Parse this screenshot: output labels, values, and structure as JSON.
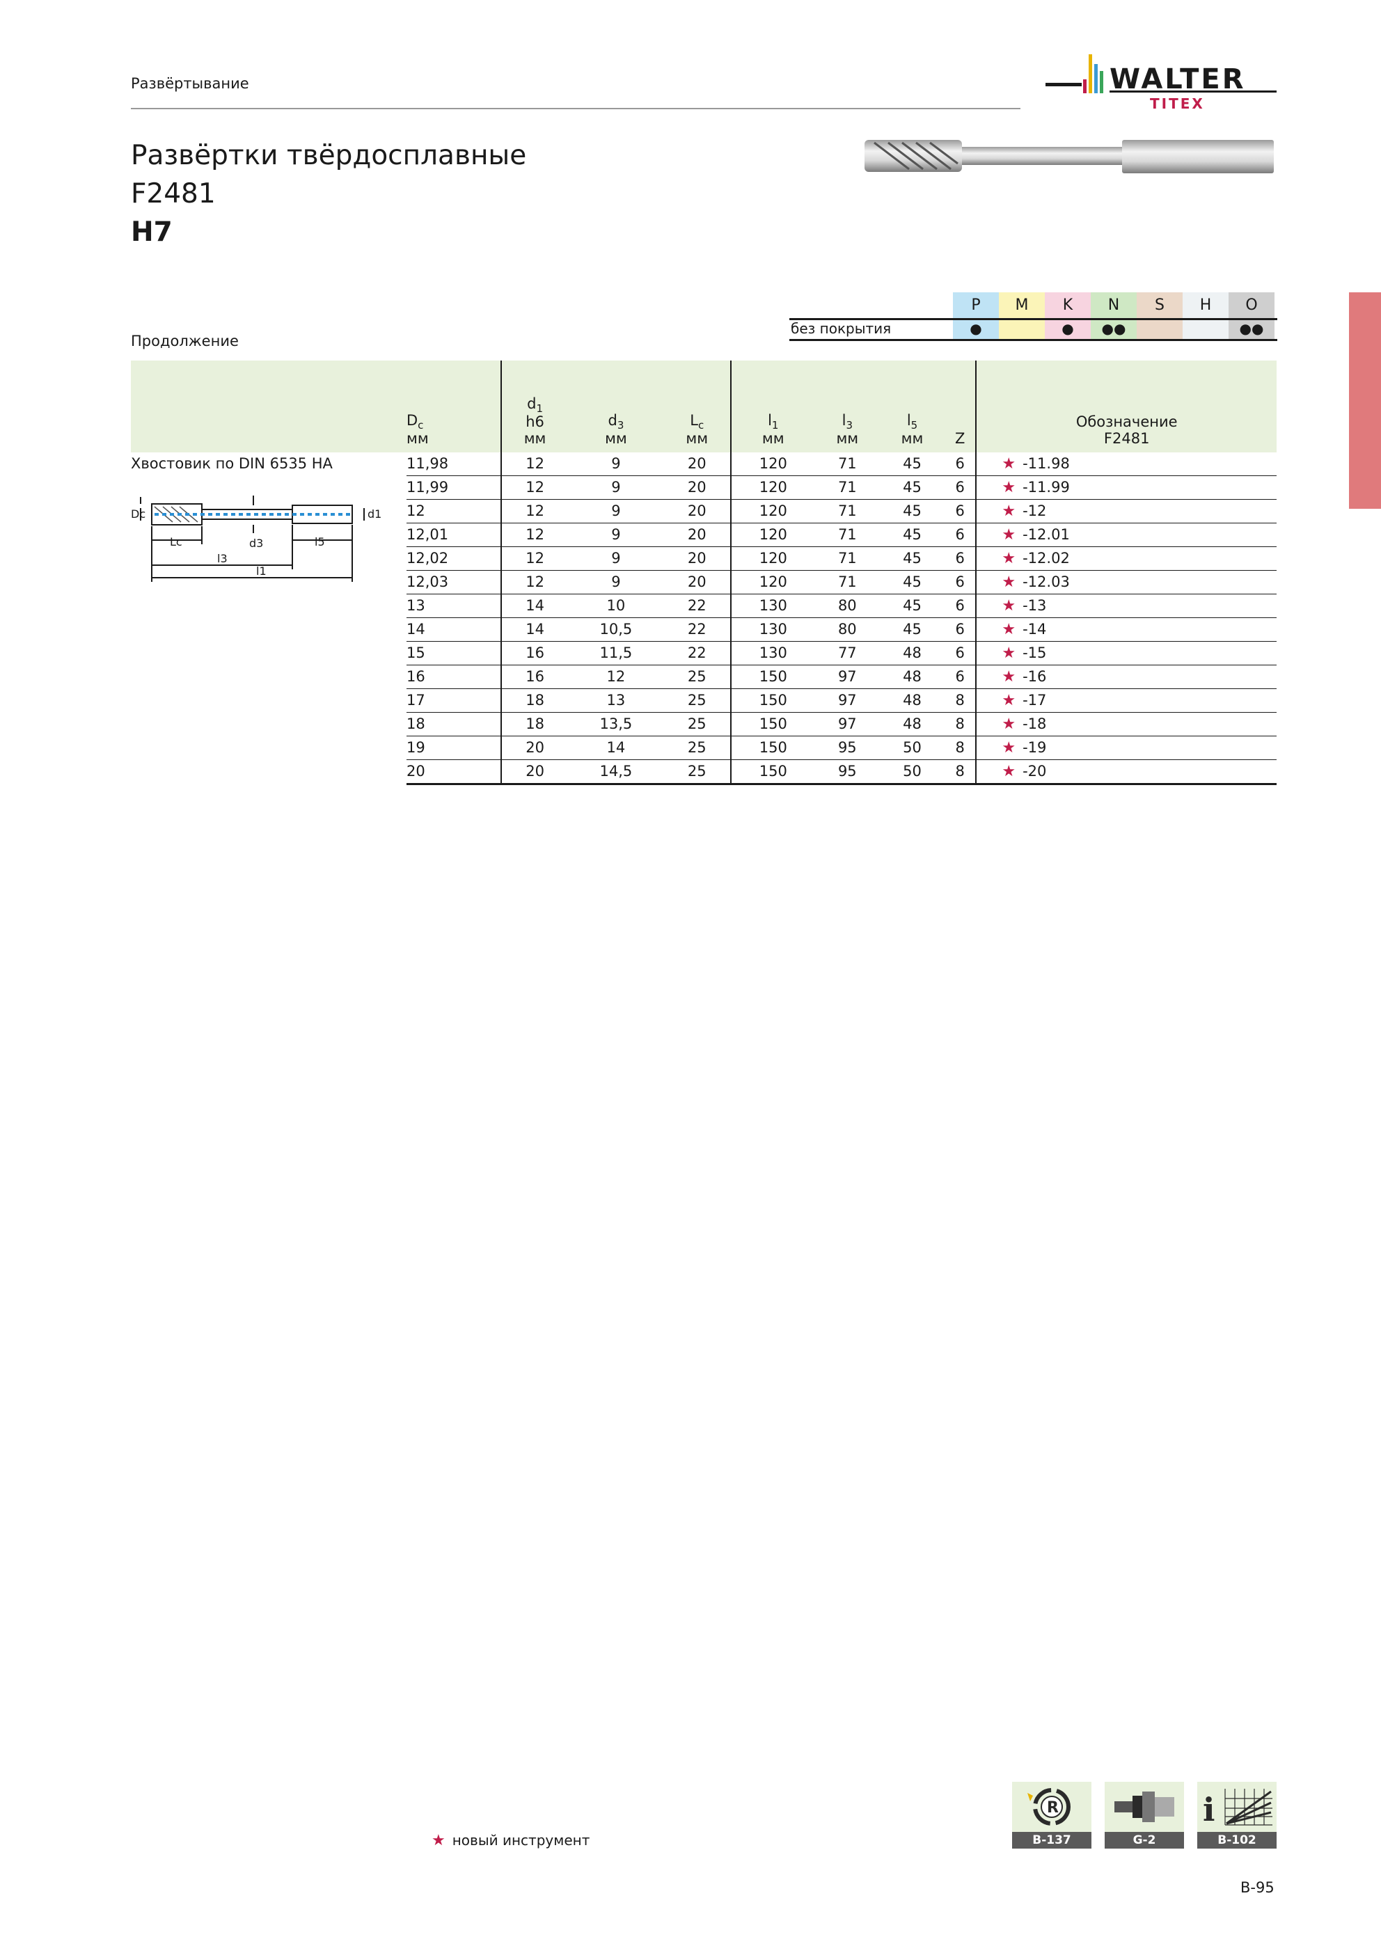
{
  "header": {
    "section": "Развёртывание",
    "brand_main": "WALTER",
    "brand_sub": "TITEX"
  },
  "title": {
    "line1": "Развёртки твёрдосплавные",
    "line2": "F2481",
    "line3": "H7"
  },
  "continued_label": "Продолжение",
  "materials": {
    "groups": [
      "P",
      "M",
      "K",
      "N",
      "S",
      "H",
      "O"
    ],
    "group_colors": [
      "#bfe3f5",
      "#fbf4b8",
      "#f7d4e0",
      "#cfe8c4",
      "#ebd8c8",
      "#eef2f4",
      "#cfcfcf"
    ],
    "coating_label": "без покрытия",
    "marks": [
      "●",
      "",
      "●",
      "●●",
      "",
      "",
      "●●"
    ]
  },
  "table": {
    "shank_label": "Хвостовик по DIN 6535 HA",
    "columns": [
      {
        "sym": "D",
        "sub": "c",
        "top": "",
        "unit": "мм"
      },
      {
        "sym": "d",
        "sub": "1",
        "top": "h6",
        "unit": "мм"
      },
      {
        "sym": "d",
        "sub": "3",
        "top": "",
        "unit": "мм"
      },
      {
        "sym": "L",
        "sub": "c",
        "top": "",
        "unit": "мм"
      },
      {
        "sym": "l",
        "sub": "1",
        "top": "",
        "unit": "мм"
      },
      {
        "sym": "l",
        "sub": "3",
        "top": "",
        "unit": "мм"
      },
      {
        "sym": "l",
        "sub": "5",
        "top": "",
        "unit": "мм"
      },
      {
        "sym": "Z",
        "sub": "",
        "top": "",
        "unit": ""
      },
      {
        "sym": "Обозначение",
        "sub": "",
        "top": "",
        "unit": "F2481"
      }
    ],
    "rows": [
      [
        "11,98",
        "12",
        "9",
        "20",
        "120",
        "71",
        "45",
        "6",
        "-11.98"
      ],
      [
        "11,99",
        "12",
        "9",
        "20",
        "120",
        "71",
        "45",
        "6",
        "-11.99"
      ],
      [
        "12",
        "12",
        "9",
        "20",
        "120",
        "71",
        "45",
        "6",
        "-12"
      ],
      [
        "12,01",
        "12",
        "9",
        "20",
        "120",
        "71",
        "45",
        "6",
        "-12.01"
      ],
      [
        "12,02",
        "12",
        "9",
        "20",
        "120",
        "71",
        "45",
        "6",
        "-12.02"
      ],
      [
        "12,03",
        "12",
        "9",
        "20",
        "120",
        "71",
        "45",
        "6",
        "-12.03"
      ],
      [
        "13",
        "14",
        "10",
        "22",
        "130",
        "80",
        "45",
        "6",
        "-13"
      ],
      [
        "14",
        "14",
        "10,5",
        "22",
        "130",
        "80",
        "45",
        "6",
        "-14"
      ],
      [
        "15",
        "16",
        "11,5",
        "22",
        "130",
        "77",
        "48",
        "6",
        "-15"
      ],
      [
        "16",
        "16",
        "12",
        "25",
        "150",
        "97",
        "48",
        "6",
        "-16"
      ],
      [
        "17",
        "18",
        "13",
        "25",
        "150",
        "97",
        "48",
        "8",
        "-17"
      ],
      [
        "18",
        "18",
        "13,5",
        "25",
        "150",
        "97",
        "48",
        "8",
        "-18"
      ],
      [
        "19",
        "20",
        "14",
        "25",
        "150",
        "95",
        "50",
        "8",
        "-19"
      ],
      [
        "20",
        "20",
        "14,5",
        "25",
        "150",
        "95",
        "50",
        "8",
        "-20"
      ]
    ],
    "new_tool_mark": "★"
  },
  "drawing_labels": {
    "dc": "Dc",
    "d1": "d1",
    "lc": "Lc",
    "d3": "d3",
    "l5": "l5",
    "l3": "l3",
    "l1": "l1"
  },
  "legend": {
    "star": "★",
    "text": "новый инструмент"
  },
  "ref_icons": [
    {
      "icon": "regrind-icon",
      "label": "B-137"
    },
    {
      "icon": "holder-icon",
      "label": "G-2"
    },
    {
      "icon": "info-chart-icon",
      "label": "B-102"
    }
  ],
  "page_number": "B-95"
}
